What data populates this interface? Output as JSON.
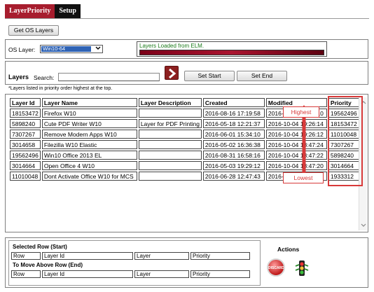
{
  "tabs": [
    {
      "label": "LayerPriority"
    },
    {
      "label": "Setup"
    }
  ],
  "toolbar": {
    "get_os_layers": "Get OS Layers"
  },
  "os": {
    "label": "OS Layer:",
    "selected": "Win10-64",
    "status": "Layers Loaded from ELM.",
    "progress": 1.0
  },
  "search": {
    "layers_label": "Layers",
    "search_label": "Search:",
    "value": "",
    "set_start": "Set Start",
    "set_end": "Set End",
    "note": "*Layers listed in priority order highest at the top."
  },
  "table": {
    "headers": [
      "Layer Id",
      "Layer Name",
      "Layer Description",
      "Created",
      "Modified",
      "Priority"
    ],
    "rows": [
      [
        "18153472",
        "Firefox W10",
        "",
        "2016-08-16 17:19:58",
        "2016-10-04 19:26:10",
        "19562496"
      ],
      [
        "5898240",
        "Cute PDF Writer W10",
        "Layer for PDF Printing",
        "2016-05-18 12:21:37",
        "2016-10-04 19:26:14",
        "18153472"
      ],
      [
        "7307267",
        "Remove Modern Apps W10",
        "",
        "2016-06-01 15:34:10",
        "2016-10-04 19:26:12",
        "11010048"
      ],
      [
        "3014658",
        "Filezilla W10 Elastic",
        "",
        "2016-05-02 16:36:38",
        "2016-10-04 18:47:24",
        "7307267"
      ],
      [
        "19562496",
        "Win10 Office 2013 EL",
        "",
        "2016-08-31 16:58:16",
        "2016-10-04 18:47:22",
        "5898240"
      ],
      [
        "3014664",
        "Open Office 4 W10",
        "",
        "2016-05-03 19:29:12",
        "2016-10-04 18:47:20",
        "3014664"
      ],
      [
        "11010048",
        "Dont Activate Office W10 for MCS",
        "",
        "2016-06-28 12:47:43",
        "2016-10-04 18:47:06",
        "1933312"
      ]
    ]
  },
  "annotations": {
    "highest": "Highest",
    "lowest": "Lowest"
  },
  "selection": {
    "start_title": "Selected Row (Start)",
    "end_title": "To Move Above Row (End)",
    "cells": [
      "Row",
      "Layer Id",
      "Layer",
      "Priority"
    ]
  },
  "actions": {
    "title": "Actions",
    "round_icon_text": "DISCARD"
  },
  "colors": {
    "accent": "#a71d2e",
    "highlight": "#d83a3a",
    "selection": "#2f63b5"
  }
}
